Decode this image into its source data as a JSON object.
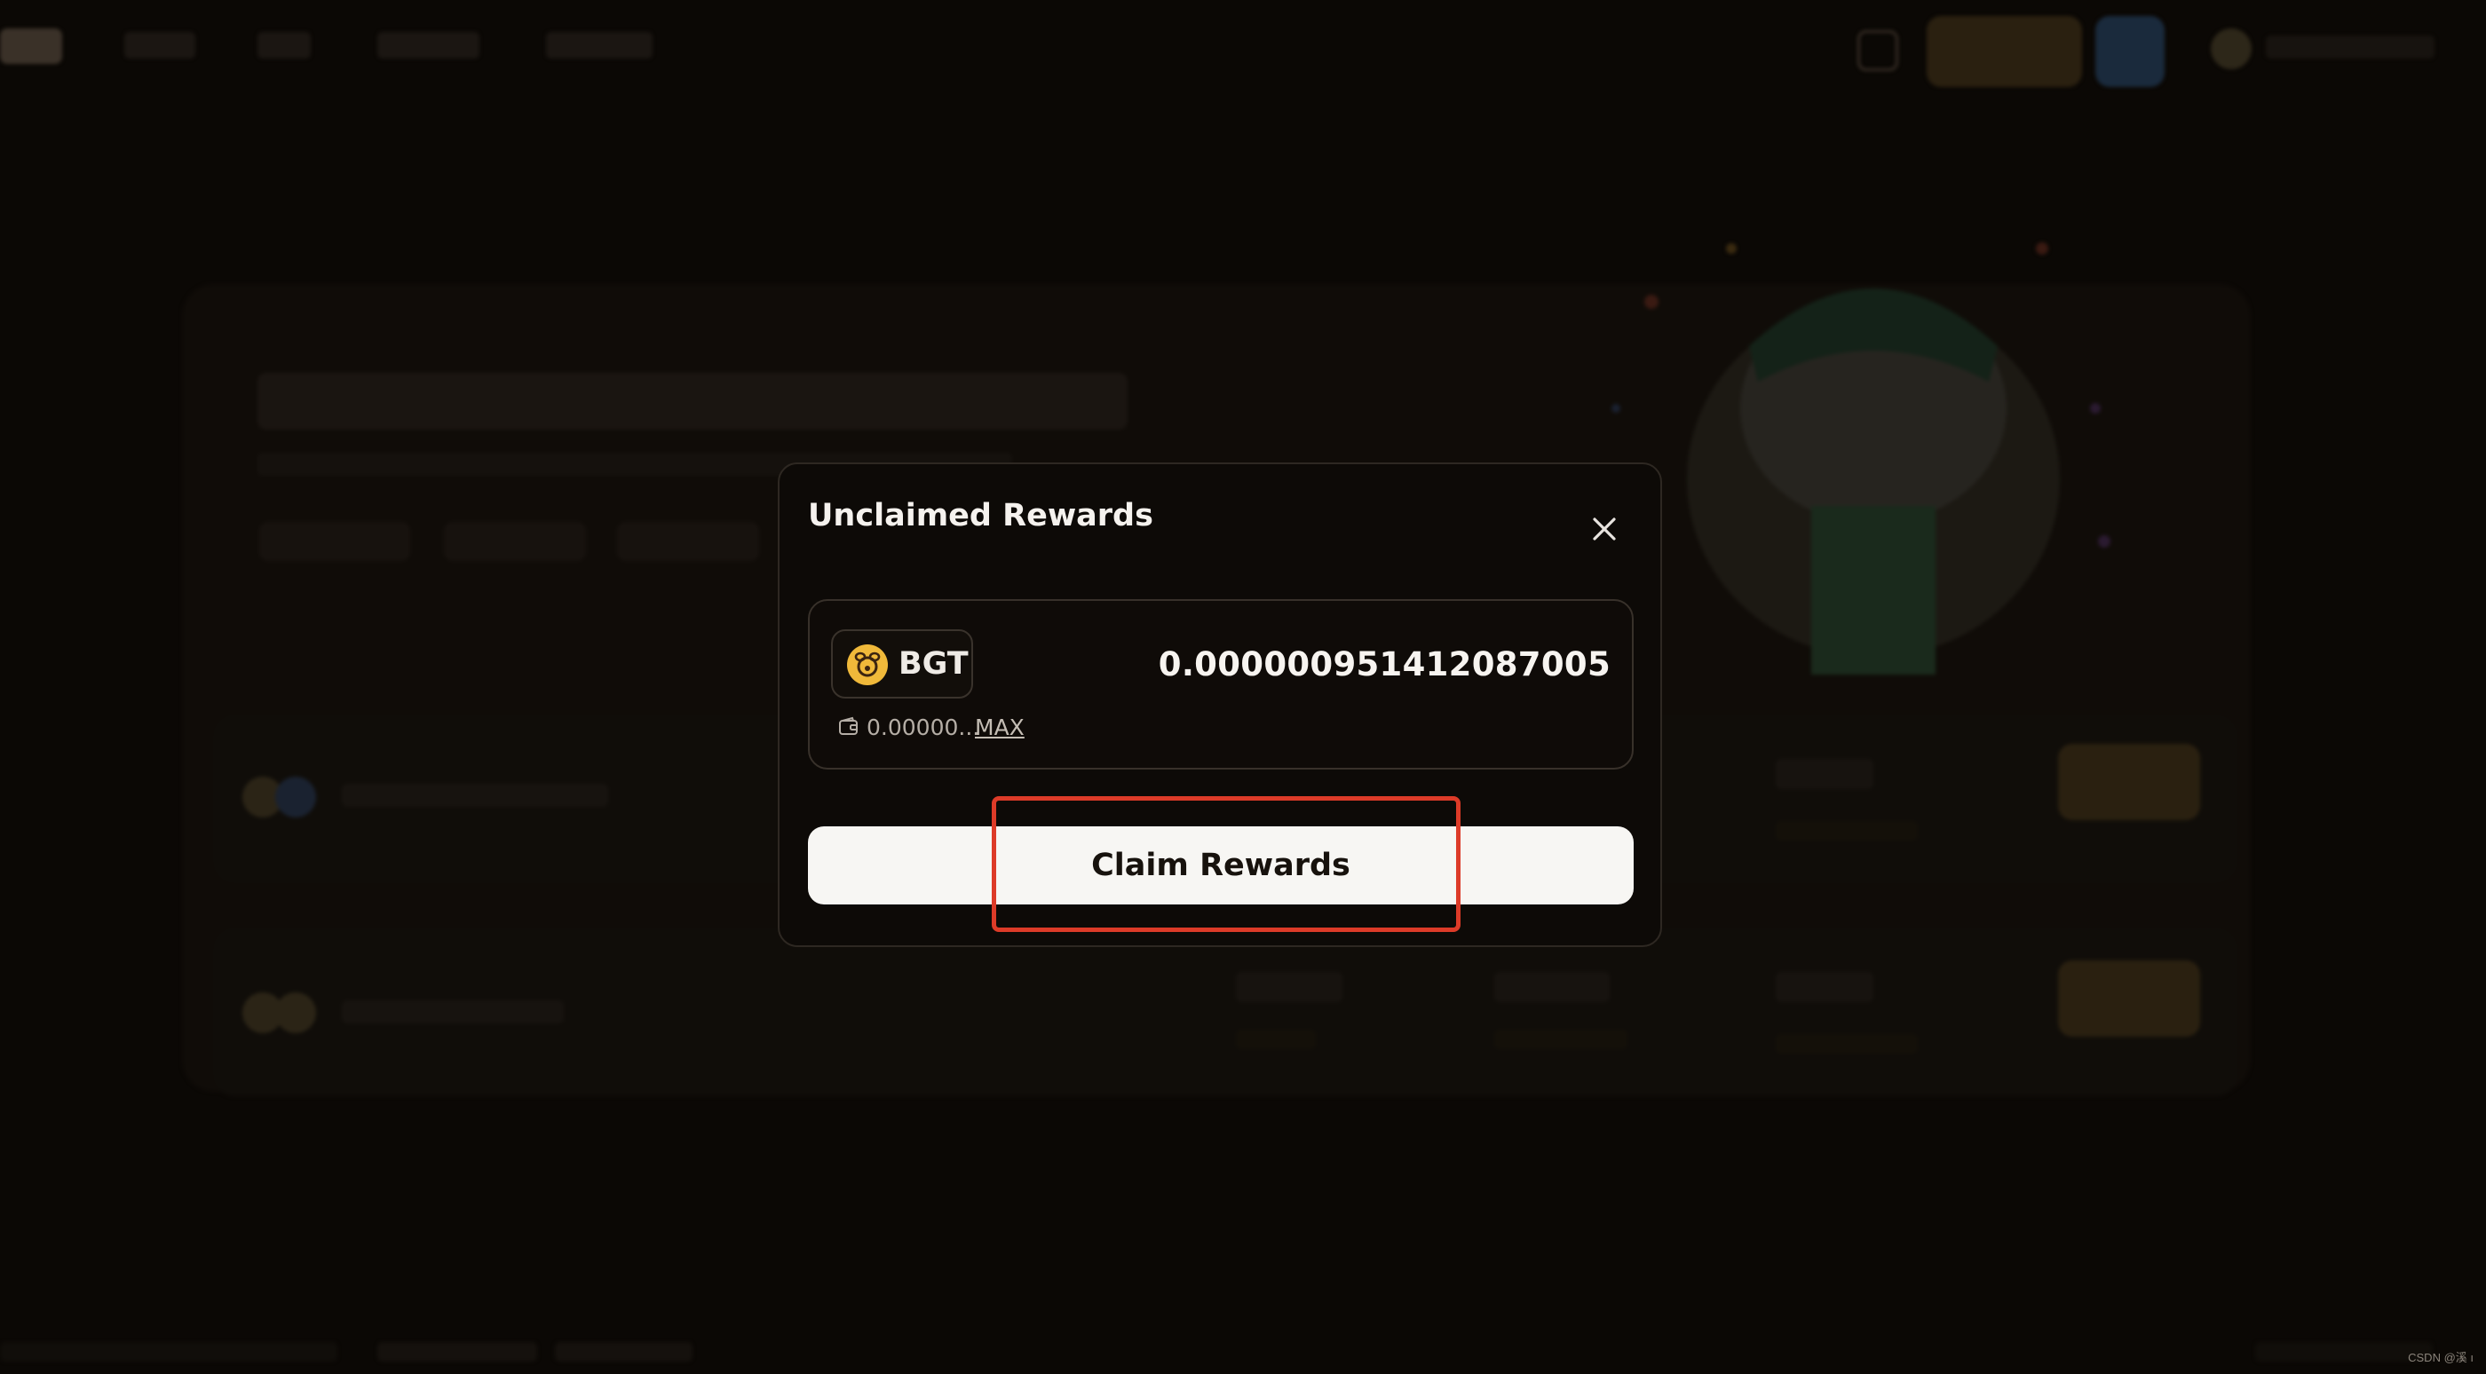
{
  "modal": {
    "title": "Unclaimed Rewards",
    "token_symbol": "BGT",
    "token_amount": "0.000000951412087005",
    "wallet_balance": "0.00000...",
    "max_label": "MAX",
    "claim_button_label": "Claim Rewards"
  },
  "icons": {
    "close": "close-icon",
    "token": "bgt-token-icon",
    "wallet": "wallet-icon"
  },
  "colors": {
    "accent": "#f0b93a",
    "highlight_outline": "#dd3b28",
    "claim_button_bg": "#f7f6f3"
  },
  "watermark": "CSDN @溪 ı"
}
